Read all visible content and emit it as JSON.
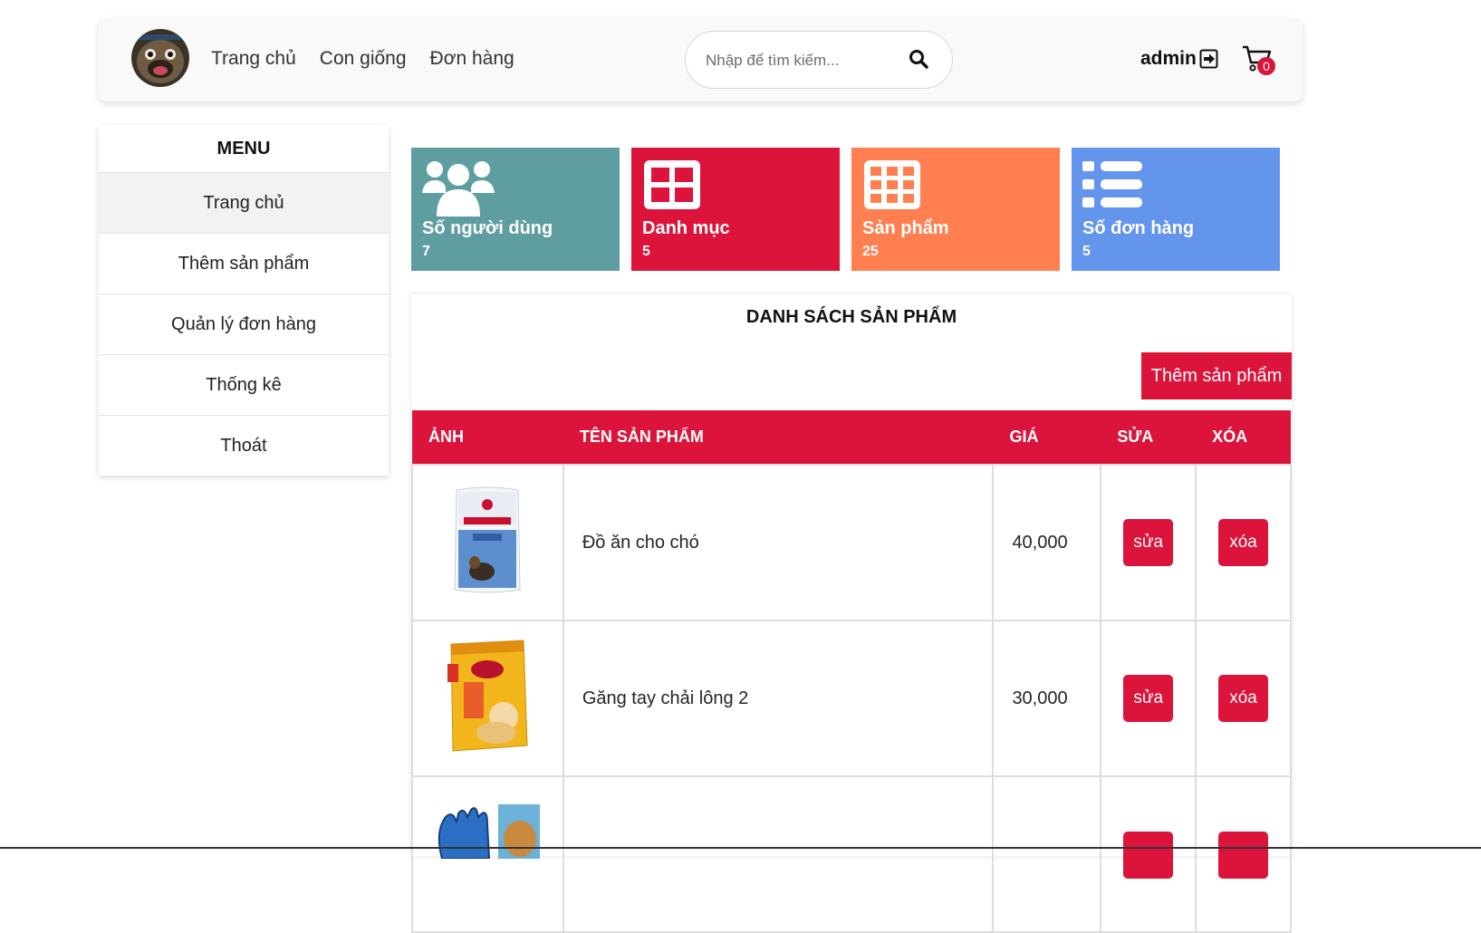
{
  "nav": {
    "links": [
      "Trang chủ",
      "Con giống",
      "Đơn hàng"
    ],
    "search_placeholder": "Nhập để tìm kiếm...",
    "user": "admin",
    "cart_count": "0"
  },
  "sidebar": {
    "title": "MENU",
    "items": [
      "Trang chủ",
      "Thêm sản phẩm",
      "Quản lý đơn hàng",
      "Thống kê",
      "Thoát"
    ]
  },
  "stats": [
    {
      "label": "Số người dùng",
      "value": "7",
      "color": "#5f9ea0",
      "icon": "users-icon"
    },
    {
      "label": "Danh mục",
      "value": "5",
      "color": "#dc143c",
      "icon": "grid-icon"
    },
    {
      "label": "Sản phẩm",
      "value": "25",
      "color": "#ff7f50",
      "icon": "apps-icon"
    },
    {
      "label": "Số đơn hàng",
      "value": "5",
      "color": "#6495ed",
      "icon": "list-icon"
    }
  ],
  "products": {
    "title": "DANH SÁCH SẢN PHẨM",
    "add_button": "Thêm sản phẩm",
    "columns": [
      "ẢNH",
      "TÊN SẢN PHẨM",
      "GIÁ",
      "SỬA",
      "XÓA"
    ],
    "rows": [
      {
        "name": "Đồ ăn cho chó",
        "price": "40,000",
        "edit": "sửa",
        "delete": "xóa",
        "image": "royal-canin-bag"
      },
      {
        "name": "Găng tay chải lông 2",
        "price": "30,000",
        "edit": "sửa",
        "delete": "xóa",
        "image": "pedigree-bag"
      },
      {
        "name": "",
        "price": "",
        "edit": "",
        "delete": "",
        "image": "grooming-glove"
      }
    ]
  },
  "colors": {
    "accent": "#dc143c"
  }
}
